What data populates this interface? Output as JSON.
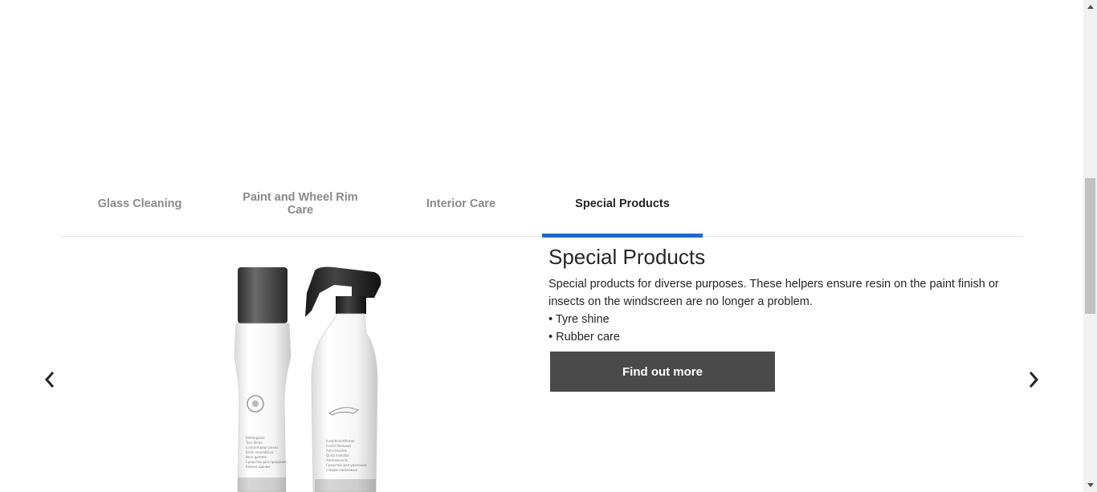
{
  "tabs": [
    {
      "label": "Glass Cleaning",
      "active": false
    },
    {
      "label": "Paint and Wheel Rim Care",
      "active": false
    },
    {
      "label": "Interior Care",
      "active": false
    },
    {
      "label": "Special Products",
      "active": true
    }
  ],
  "panel": {
    "title": "Special Products",
    "description": "Special products for diverse purposes. These helpers ensure resin on the paint finish or insects on the windscreen are no longer a problem.",
    "bullets": [
      "• Tyre shine",
      "• Rubber care"
    ],
    "button_label": "Find out more"
  },
  "carousel": {
    "prev_icon": "chevron-left-icon",
    "next_icon": "chevron-right-icon"
  },
  "product_image": {
    "bottle1_label": [
      "Reifenglanz",
      "Tyre Shine",
      "Lustrant pour pneus",
      "Brillo neumáticos",
      "Nero gomme",
      "Средство для придания",
      "блеска шинам"
    ],
    "bottle2_label": [
      "Insektenentferner",
      "Insect Remover",
      "Anti-insectes",
      "Quita insectos",
      "Antimoscerini",
      "Средство для удаления",
      "следов насекомых"
    ],
    "brand_text": "Original BMW Care Products"
  },
  "colors": {
    "accent": "#1c69d4",
    "button_bg": "#4a4a4a",
    "inactive_tab": "#8a8a8a"
  }
}
